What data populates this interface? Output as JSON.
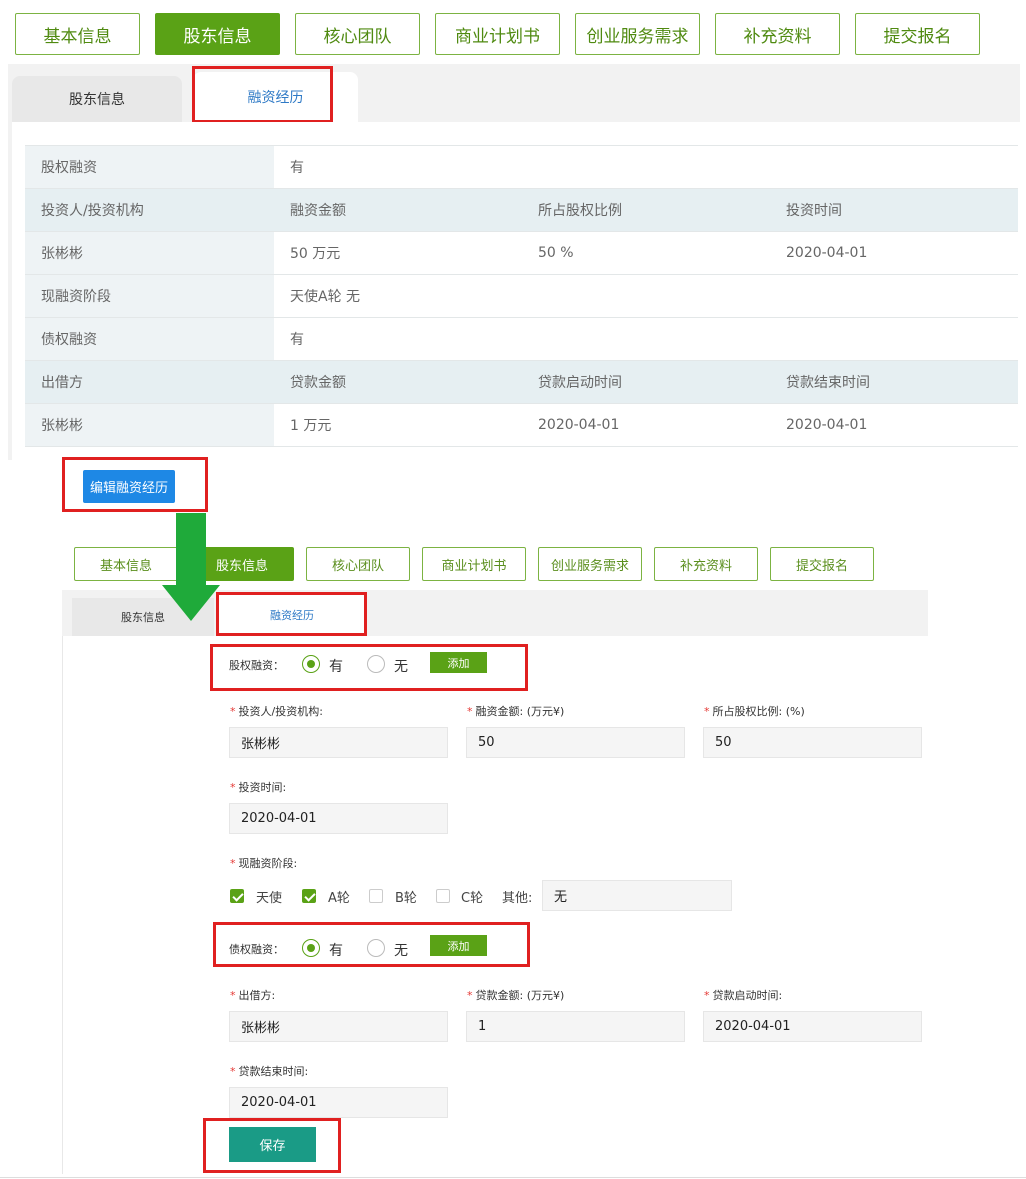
{
  "steps": [
    "基本信息",
    "股东信息",
    "核心团队",
    "商业计划书",
    "创业服务需求",
    "补充资料",
    "提交报名"
  ],
  "active_step": "股东信息",
  "sub_tabs": [
    "股东信息",
    "融资经历"
  ],
  "table": {
    "equity_label": "股权融资",
    "equity_value": "有",
    "inv_headers": [
      "投资人/投资机构",
      "融资金额",
      "所占股权比例",
      "投资时间"
    ],
    "inv_row": [
      "张彬彬",
      "50 万元",
      "50 %",
      "2020-04-01"
    ],
    "stage_label": "现融资阶段",
    "stage_value": "天使A轮 无",
    "debt_label": "债权融资",
    "debt_value": "有",
    "loan_headers": [
      "出借方",
      "贷款金额",
      "贷款启动时间",
      "贷款结束时间"
    ],
    "loan_row": [
      "张彬彬",
      "1 万元",
      "2020-04-01",
      "2020-04-01"
    ]
  },
  "edit_button": "编辑融资经历",
  "colors": {
    "green": "#5aa216",
    "blue": "#1e88e5",
    "teal": "#1a9b86",
    "red_highlight": "#e02020",
    "arrow": "#1faa3a"
  },
  "form": {
    "equity_label": "股权融资：",
    "yes": "有",
    "no": "无",
    "add": "添加",
    "investor_label": "投资人/投资机构:",
    "amount_label": "融资金额: (万元¥)",
    "ratio_label": "所占股权比例: (%)",
    "invest_time_label": "投资时间:",
    "investor_value": "张彬彬",
    "amount_value": "50",
    "ratio_value": "50",
    "invest_time_value": "2020-04-01",
    "stage_label": "现融资阶段:",
    "stage_options": [
      "天使",
      "A轮",
      "B轮",
      "C轮"
    ],
    "stage_checked": [
      true,
      true,
      false,
      false
    ],
    "other_label": "其他:",
    "other_value": "无",
    "debt_label": "债权融资：",
    "lender_label": "出借方:",
    "loan_amount_label": "贷款金额: (万元¥)",
    "loan_start_label": "贷款启动时间:",
    "loan_end_label": "贷款结束时间:",
    "lender_value": "张彬彬",
    "loan_amount_value": "1",
    "loan_start_value": "2020-04-01",
    "loan_end_value": "2020-04-01",
    "save": "保存"
  }
}
